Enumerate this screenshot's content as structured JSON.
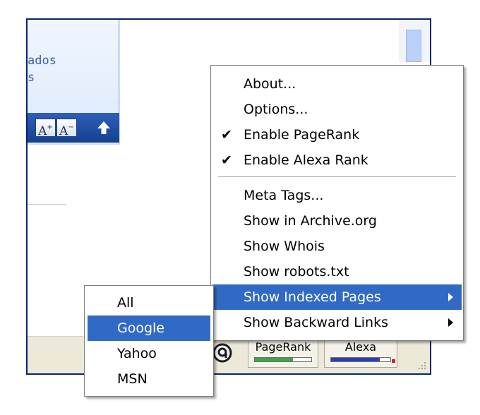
{
  "page": {
    "side_links": [
      "ados",
      "s"
    ],
    "font_increase": "A",
    "font_decrease": "A"
  },
  "status_bar": {
    "pagerank_label": "PageRank",
    "pagerank_fill": 0.67,
    "alexa_label": "Alexa",
    "alexa_fill": 0.82,
    "colors": {
      "pagerank_bar": "#3ea34a",
      "alexa_bar": "#2a3fb0"
    }
  },
  "context_menu": {
    "items": [
      {
        "label": "About...",
        "checked": false
      },
      {
        "label": "Options...",
        "checked": false
      },
      {
        "label": "Enable PageRank",
        "checked": true
      },
      {
        "label": "Enable Alexa Rank",
        "checked": true
      },
      {
        "label": "Meta Tags...",
        "checked": false
      },
      {
        "label": "Show in Archive.org",
        "checked": false
      },
      {
        "label": "Show Whois",
        "checked": false
      },
      {
        "label": "Show robots.txt",
        "checked": false
      },
      {
        "label": "Show Indexed Pages",
        "submenu": true,
        "highlighted": true
      },
      {
        "label": "Show Backward Links",
        "submenu": true
      }
    ],
    "check_glyph": "✔"
  },
  "submenu": {
    "items": [
      {
        "label": "All"
      },
      {
        "label": "Google",
        "highlighted": true
      },
      {
        "label": "Yahoo"
      },
      {
        "label": "MSN"
      }
    ]
  },
  "colors": {
    "highlight": "#316ac5",
    "window_border": "#0a246a",
    "status_bar_bg": "#ece9d8"
  }
}
